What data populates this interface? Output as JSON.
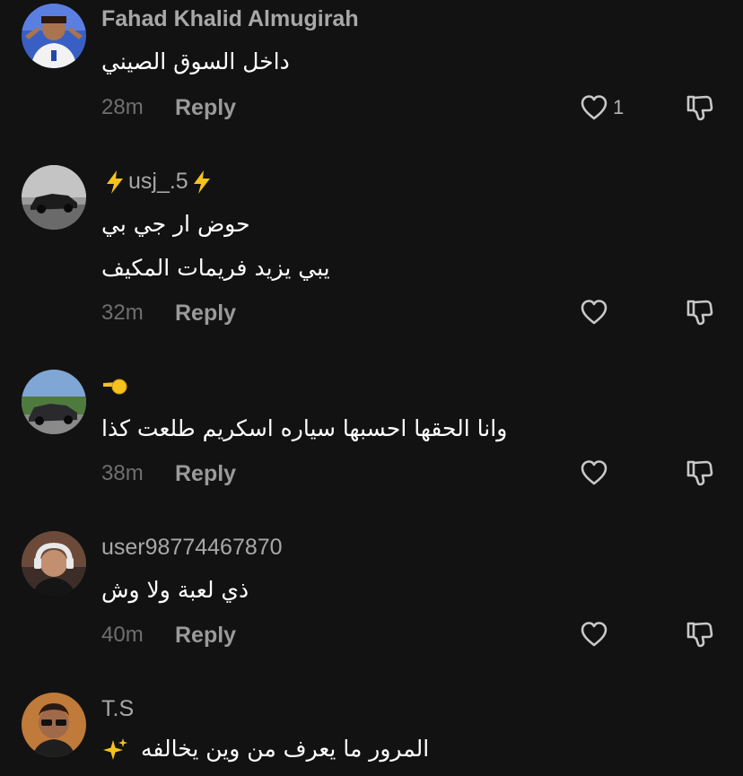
{
  "comments": [
    {
      "username": "Fahad Khalid Almugirah",
      "lines": [
        "داخل السوق الصيني"
      ],
      "time": "28m",
      "reply_label": "Reply",
      "likes": "1",
      "avatar_icon": "football-player-avatar"
    },
    {
      "username": "usj_.5",
      "username_icons": [
        "lightning-emoji",
        "lightning-emoji"
      ],
      "lines": [
        "حوض ار جي بي",
        "يبي يزيد فريمات المكيف"
      ],
      "time": "32m",
      "reply_label": "Reply",
      "likes": "",
      "avatar_icon": "sports-car-avatar"
    },
    {
      "username": "",
      "username_icons": [
        "pointing-hand-emoji"
      ],
      "lines": [
        "وانا الحقها احسبها سياره اسكريم طلعت كذا"
      ],
      "time": "38m",
      "reply_label": "Reply",
      "likes": "",
      "avatar_icon": "car-avatar"
    },
    {
      "username": "user98774467870",
      "lines": [
        "ذي لعبة ولا وش"
      ],
      "time": "40m",
      "reply_label": "Reply",
      "likes": "",
      "avatar_icon": "headset-person-avatar"
    },
    {
      "username": "T.S",
      "lines": [
        "المرور ما يعرف من وين يخالفه"
      ],
      "line_icon": "sparkles-emoji",
      "time": "",
      "reply_label": "",
      "likes": "",
      "avatar_icon": "person-sunglasses-avatar"
    }
  ],
  "colors": {
    "background": "#121212",
    "username": "#a8a8a8",
    "comment_text": "#ffffff",
    "time": "#6f6f6f",
    "reply": "#9a9a9a",
    "icon": "#c8c8c8"
  }
}
